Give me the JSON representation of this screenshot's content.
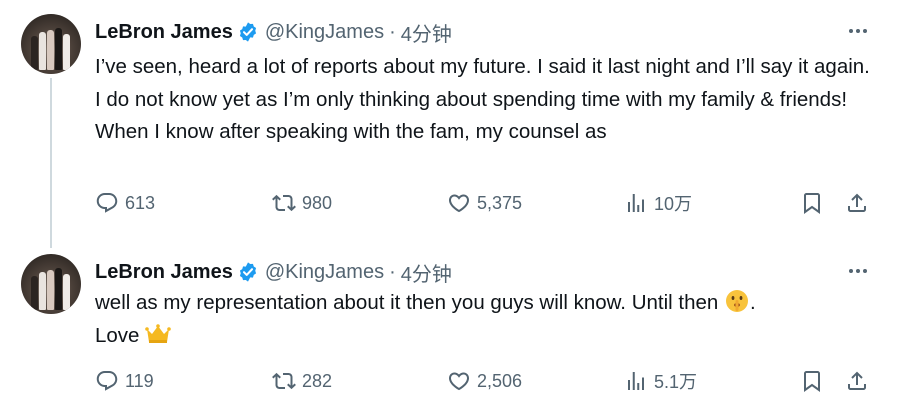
{
  "tweets": [
    {
      "name": "LeBron James",
      "handle": "@KingJames",
      "separator": "·",
      "time": "4分钟",
      "text": "I’ve seen, heard a lot of reports about my future. I said it last night and I’ll say it again. I do not know yet as I’m only thinking about spending time with my family & friends! When I know after speaking with the fam, my counsel as",
      "replies": "613",
      "retweets": "980",
      "likes": "5,375",
      "views": "10万"
    },
    {
      "name": "LeBron James",
      "handle": "@KingJames",
      "separator": "·",
      "time": "4分钟",
      "text_part1": "well as my representation about it then you guys will know. Until then ",
      "text_part2": ".",
      "text_part3": "Love ",
      "replies": "119",
      "retweets": "282",
      "likes": "2,506",
      "views": "5.1万"
    }
  ],
  "icons": {
    "verified": "verified-badge-icon",
    "more": "more-icon",
    "reply": "reply-icon",
    "retweet": "retweet-icon",
    "like": "heart-icon",
    "views": "views-chart-icon",
    "bookmark": "bookmark-icon",
    "share": "share-icon",
    "emoji1": "shushing-face-emoji",
    "emoji2": "crown-emoji"
  },
  "colors": {
    "verified": "#1d9bf0",
    "text": "#0f1419",
    "secondary": "#536471",
    "thread_line": "#cfd9de"
  }
}
